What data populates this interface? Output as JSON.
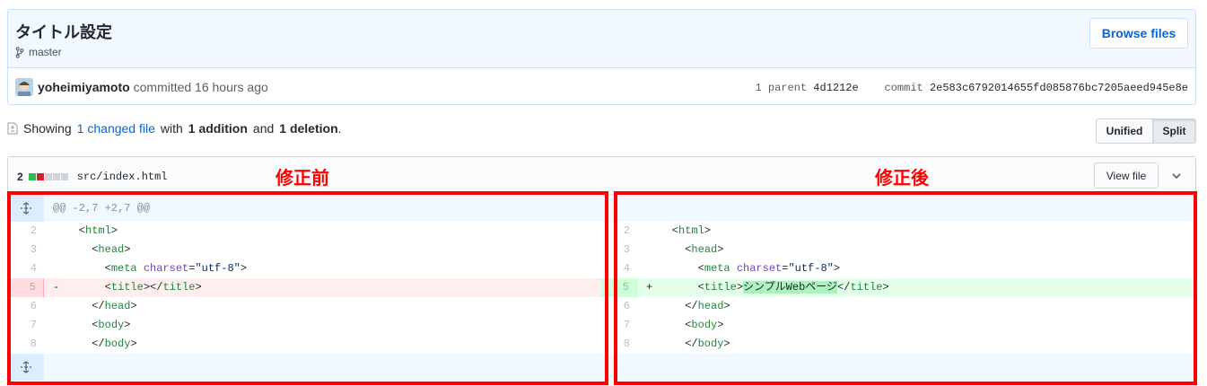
{
  "commit": {
    "title": "タイトル設定",
    "branch": "master",
    "browse_button": "Browse files",
    "author": "yoheimiyamoto",
    "committed_text": "committed 16 hours ago",
    "parent_label": "1 parent",
    "parent_sha": "4d1212e",
    "commit_label": "commit",
    "commit_sha": "2e583c6792014655fd085876bc7205aeed945e8e"
  },
  "toc": {
    "showing": "Showing",
    "changed_files": "1 changed file",
    "with": "with",
    "additions": "1 addition",
    "and": "and",
    "deletions": "1 deletion",
    "period": "."
  },
  "view_toggle": {
    "unified": "Unified",
    "split": "Split",
    "selected": "Split"
  },
  "file": {
    "change_count": "2",
    "name": "src/index.html",
    "view_file_button": "View file",
    "diffstat_colors": [
      "#2cbe4e",
      "#cb2431",
      "#d1d5da",
      "#d1d5da",
      "#d1d5da"
    ]
  },
  "annotations": {
    "before": "修正前",
    "after": "修正後"
  },
  "diff": {
    "hunk_header": "@@ -2,7 +2,7 @@",
    "left": [
      {
        "num": "2",
        "sign": " ",
        "indent": "  ",
        "open": "<",
        "tag": "html",
        "rest": ">"
      },
      {
        "num": "3",
        "sign": " ",
        "indent": "    ",
        "open": "<",
        "tag": "head",
        "rest": ">"
      },
      {
        "num": "4",
        "sign": " ",
        "indent": "      "
      },
      {
        "num": "5",
        "sign": "-",
        "indent": "      "
      },
      {
        "num": "6",
        "sign": " ",
        "indent": "    "
      },
      {
        "num": "7",
        "sign": " ",
        "indent": "    "
      },
      {
        "num": "8",
        "sign": " ",
        "indent": "    "
      }
    ],
    "right": [
      {
        "num": "2"
      },
      {
        "num": "3"
      },
      {
        "num": "4"
      },
      {
        "num": "5"
      },
      {
        "num": "6"
      },
      {
        "num": "7"
      },
      {
        "num": "8"
      }
    ],
    "title_text_added": "シンプルWebページ"
  },
  "colors": {
    "accent_blue": "#0366d6",
    "annotation_red": "#ff0000",
    "deletion_bg": "#ffeef0",
    "addition_bg": "#e6ffed"
  }
}
